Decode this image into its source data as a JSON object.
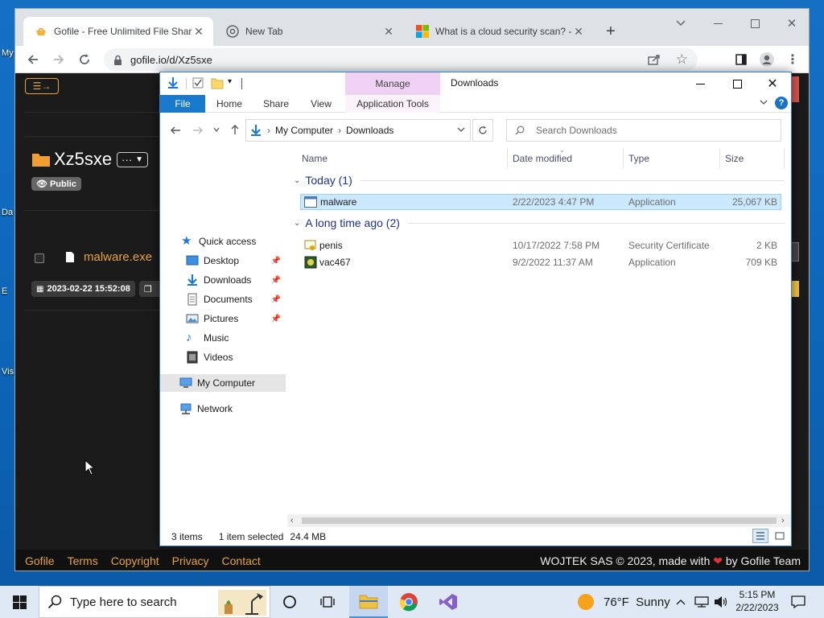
{
  "desktop": {
    "labels": [
      "My",
      "Da",
      "E",
      "Vis"
    ]
  },
  "browser": {
    "tabs": [
      {
        "title": "Gofile - Free Unlimited File Shari",
        "active": true
      },
      {
        "title": "New Tab",
        "active": false
      },
      {
        "title": "What is a cloud security scan? - ",
        "active": false
      }
    ],
    "new_tab": "+",
    "url": "gofile.io/d/Xz5sxe"
  },
  "gofile": {
    "folder_name": "Xz5sxe",
    "more": "···",
    "badge": "Public",
    "file_name": "malware.exe",
    "date": "2023-02-22 15:52:08",
    "footer_links": [
      "Gofile",
      "Terms",
      "Copyright",
      "Privacy",
      "Contact"
    ],
    "footer_pre": "WOJTEK SAS © 2023, made with",
    "footer_post": "by Gofile Team",
    "accent": "#e5a43b"
  },
  "explorer": {
    "title": "Downloads",
    "manage_label": "Manage",
    "ribbon_tabs": [
      "File",
      "Home",
      "Share",
      "View",
      "Application Tools"
    ],
    "breadcrumb": [
      "My Computer",
      "Downloads"
    ],
    "search_placeholder": "Search Downloads",
    "nav": {
      "quick_access": "Quick access",
      "items": [
        "Desktop",
        "Downloads",
        "Documents",
        "Pictures",
        "Music",
        "Videos"
      ],
      "my_computer": "My Computer",
      "network": "Network"
    },
    "columns": [
      "Name",
      "Date modified",
      "Type",
      "Size"
    ],
    "groups": [
      {
        "label": "Today (1)",
        "files": [
          {
            "name": "malware",
            "date": "2/22/2023 4:47 PM",
            "type": "Application",
            "size": "25,067 KB"
          }
        ]
      },
      {
        "label": "A long time ago (2)",
        "files": [
          {
            "name": "penis",
            "date": "10/17/2022 7:58 PM",
            "type": "Security Certificate",
            "size": "2 KB"
          },
          {
            "name": "vac467",
            "date": "9/2/2022 11:37 AM",
            "type": "Application",
            "size": "709 KB"
          }
        ]
      }
    ],
    "status": {
      "items": "3 items",
      "selected": "1 item selected",
      "size": "24.4 MB"
    }
  },
  "taskbar": {
    "search_placeholder": "Type here to search",
    "weather": "76°F  Sunny",
    "time": "5:15 PM",
    "date": "2/22/2023"
  }
}
